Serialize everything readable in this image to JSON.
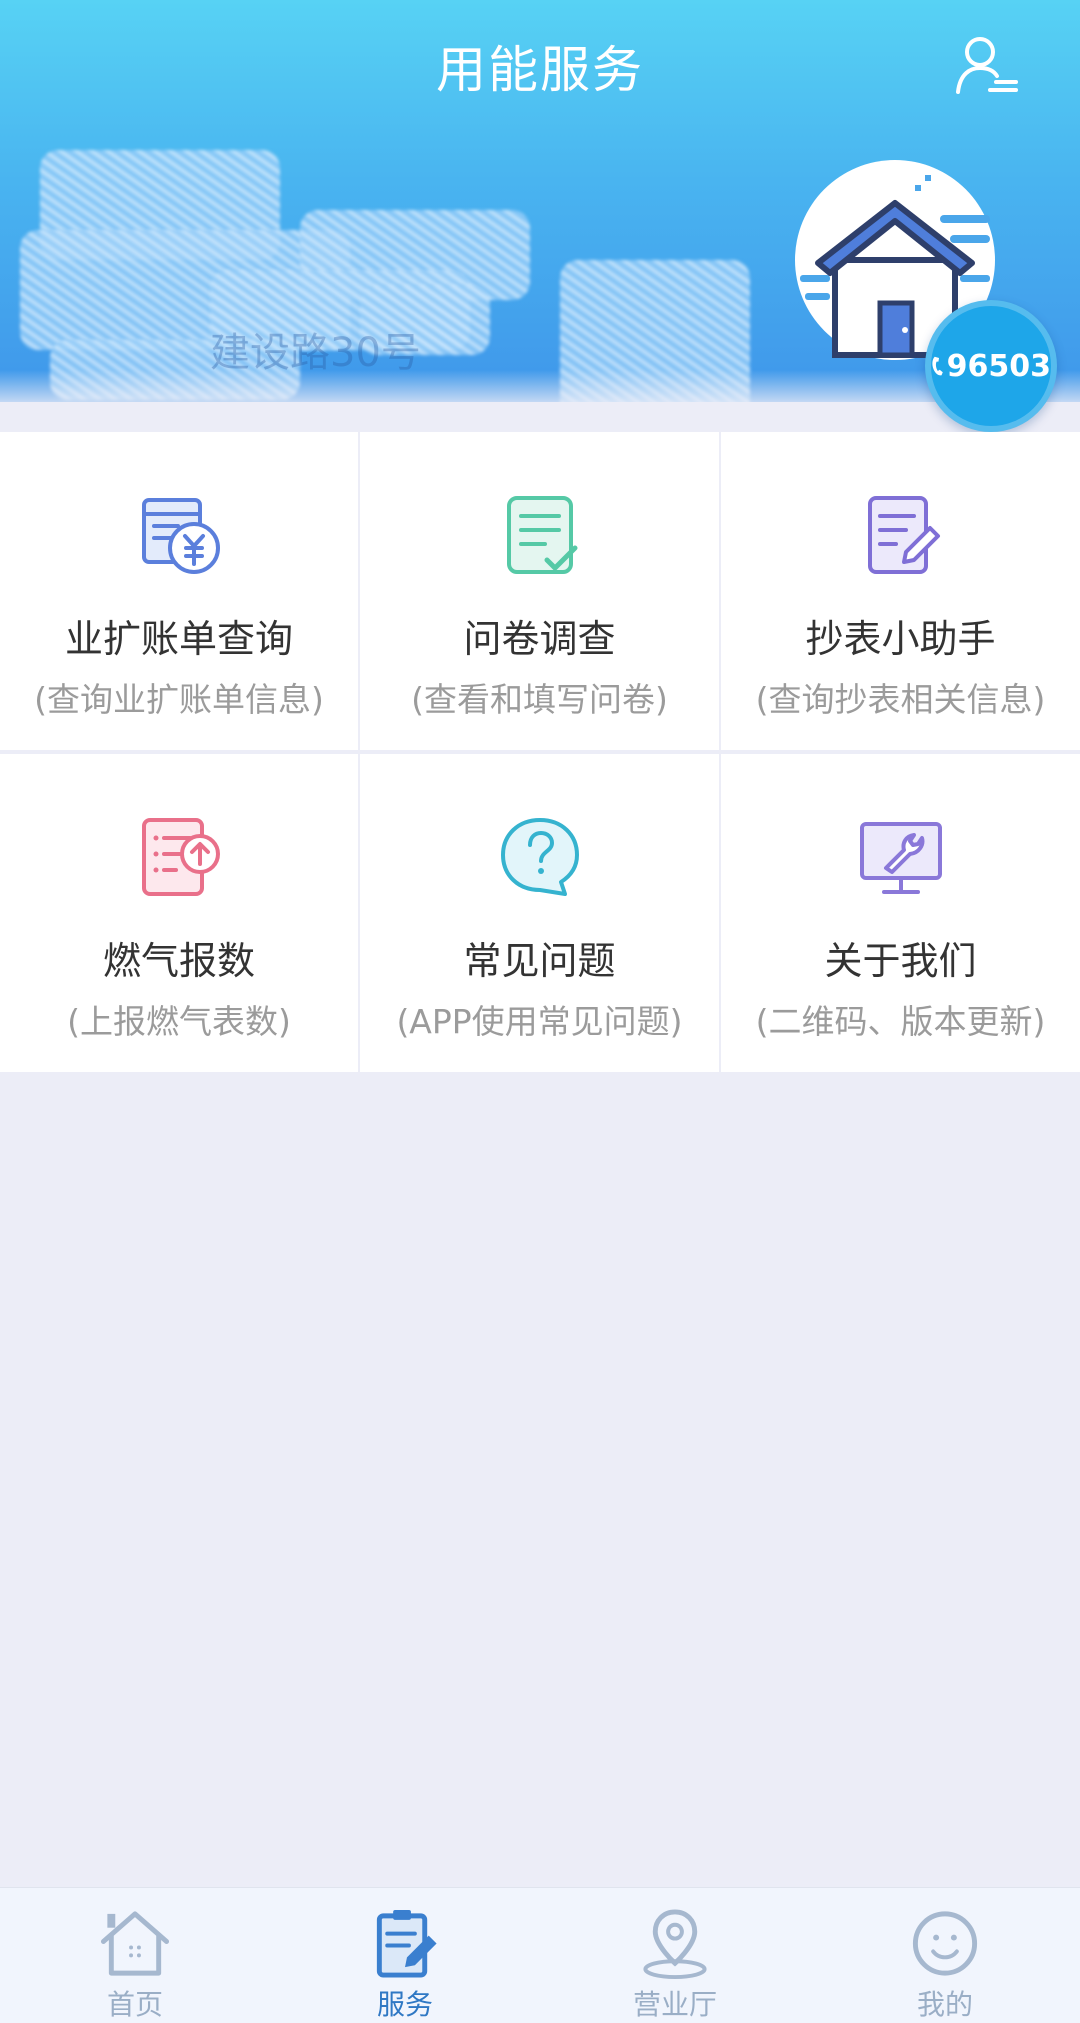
{
  "header": {
    "title": "用能服务",
    "user_menu_icon": "user-list-icon",
    "address_text": "建设路30号"
  },
  "hotline": {
    "number": "96503",
    "icon": "phone-icon"
  },
  "services": [
    {
      "title": "业扩账单查询",
      "subtitle": "(查询业扩账单信息)",
      "icon": "bill-yuan-icon",
      "color": "#5b7fdc"
    },
    {
      "title": "问卷调查",
      "subtitle": "(查看和填写问卷)",
      "icon": "questionnaire-check-icon",
      "color": "#55c9a6"
    },
    {
      "title": "抄表小助手",
      "subtitle": "(查询抄表相关信息)",
      "icon": "meter-edit-icon",
      "color": "#7f6fd6"
    },
    {
      "title": "燃气报数",
      "subtitle": "(上报燃气表数)",
      "icon": "report-upload-icon",
      "color": "#e9708a"
    },
    {
      "title": "常见问题",
      "subtitle": "(APP使用常见问题)",
      "icon": "faq-question-icon",
      "color": "#35b3cf"
    },
    {
      "title": "关于我们",
      "subtitle": "(二维码、版本更新)",
      "icon": "monitor-wrench-icon",
      "color": "#8a78d9"
    }
  ],
  "nav": {
    "active_color": "#2f78c4",
    "inactive_color": "#9aaec6",
    "items": [
      {
        "label": "首页",
        "icon": "home-icon"
      },
      {
        "label": "服务",
        "icon": "service-clipboard-icon"
      },
      {
        "label": "营业厅",
        "icon": "location-pin-icon"
      },
      {
        "label": "我的",
        "icon": "profile-icon"
      }
    ]
  }
}
